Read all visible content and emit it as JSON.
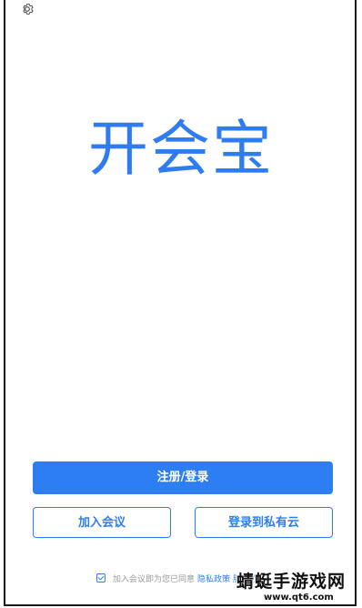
{
  "app": {
    "logo_text": "开会宝"
  },
  "header": {
    "settings_icon": "gear-icon"
  },
  "actions": {
    "register_login_label": "注册/登录",
    "join_meeting_label": "加入会议",
    "private_cloud_login_label": "登录到私有云"
  },
  "agreement": {
    "checked": true,
    "text": "加入会议即为您已同意",
    "privacy_link": "隐私政策",
    "terms_link": "服务协议"
  },
  "watermark": {
    "title": "蜻蜓手游戏网",
    "url": "www.qt6.com"
  },
  "colors": {
    "accent": "#2d7df3",
    "logo": "#2f7cf0",
    "muted_text": "#9a9a9a"
  }
}
